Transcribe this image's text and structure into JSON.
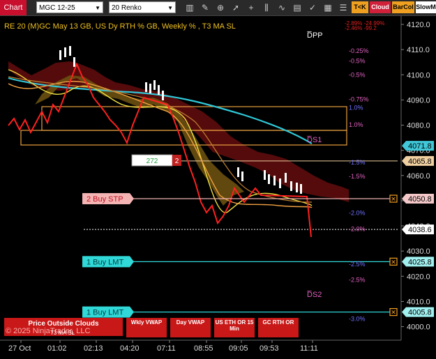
{
  "toolbar": {
    "chart_tab": "Chart",
    "instrument": "MGC 12-25",
    "bar_type": "20 Renko",
    "badges": [
      "T<K",
      "Cloud",
      "BarCol",
      "SlowM"
    ],
    "badge_colors": [
      "#f0a020",
      "#d0203a",
      "#f0a020",
      "#ffffff"
    ],
    "icons": [
      "bar-chart-icon",
      "drawing-tools-icon",
      "zoom-icon",
      "pointer-icon",
      "crosshair-icon",
      "bars-icon",
      "indicators-icon",
      "strategy-icon",
      "properties-icon",
      "data-box-icon"
    ]
  },
  "chart": {
    "header": "RE 20  (M)GC May 13 GB, US Dy RTH % GB, Weekly % , T3 MA SL",
    "top_right_overlap": [
      "-2.89%  -24.99%",
      "-2.46% -99.2"
    ],
    "zone_labels": {
      "dpp": "D̅PP",
      "ds1": "D̅S1",
      "ds2": "D̅S2"
    },
    "percent_labels": [
      {
        "text": "-0.25%",
        "price": 4109.5,
        "color": "#e060c0"
      },
      {
        "text": "-0.5%",
        "price": 4105.5,
        "color": "#e060c0"
      },
      {
        "text": "-0.5%",
        "price": 4100.0,
        "color": "#e060c0"
      },
      {
        "text": "-0.75%",
        "price": 4090.2,
        "color": "#e060c0"
      },
      {
        "text": "1.0%",
        "price": 4086.9,
        "color": "#7070ff"
      },
      {
        "text": "1.0%",
        "price": 4080.2,
        "color": "#e060c0"
      },
      {
        "text": "-1.5%",
        "price": 4065.2,
        "color": "#7070ff"
      },
      {
        "text": "-1.5%",
        "price": 4059.6,
        "color": "#e060c0"
      },
      {
        "text": "-2.0%",
        "price": 4045.2,
        "color": "#7070ff"
      },
      {
        "text": "-2.0%",
        "price": 4038.8,
        "color": "#e060c0"
      },
      {
        "text": "-2.5%",
        "price": 4024.8,
        "color": "#7070ff"
      },
      {
        "text": "-2.5%",
        "price": 4018.6,
        "color": "#e060c0"
      },
      {
        "text": "-3.0%",
        "price": 4003.0,
        "color": "#7070ff"
      }
    ],
    "price_axis": {
      "ticks": [
        "4120.0",
        "4110.0",
        "4100.0",
        "4090.0",
        "4080.0",
        "4070.0",
        "4060.0",
        "4050.0",
        "4040.0",
        "4030.0",
        "4020.0",
        "4010.0",
        "4000.0"
      ],
      "tick_values": [
        4120,
        4110,
        4100,
        4090,
        4080,
        4070,
        4060,
        4050,
        4040,
        4030,
        4020,
        4010,
        4000
      ],
      "markers": [
        {
          "label": "4071.8",
          "price": 4071.8,
          "bg": "#40c8d8",
          "fg": "#000000"
        },
        {
          "label": "4065.8",
          "price": 4065.8,
          "bg": "#f0d0a0",
          "fg": "#000000"
        },
        {
          "label": "4050.8",
          "price": 4050.8,
          "bg": "#f4c8c8",
          "fg": "#000000"
        },
        {
          "label": "4038.6",
          "price": 4038.6,
          "bg": "#ffffff",
          "fg": "#000000"
        },
        {
          "label": "4025.8",
          "price": 4025.8,
          "bg": "#a0f0f0",
          "fg": "#000000"
        },
        {
          "label": "4005.8",
          "price": 4005.8,
          "bg": "#a0f0f0",
          "fg": "#000000"
        }
      ]
    },
    "time_axis": {
      "labels": [
        "27 Oct",
        "01:02",
        "02:13",
        "04:20",
        "07:11",
        "08:55",
        "09:05",
        "09:53",
        "11:11"
      ]
    },
    "orders": [
      {
        "label": "2 Buy STP",
        "price": 4050.8,
        "color": "#f4b4b4",
        "fg": "#c01020"
      },
      {
        "label": "1 Buy LMT",
        "price": 4025.8,
        "color": "#30d8d8",
        "fg": "#004040"
      },
      {
        "label": "1 Buy LMT",
        "price": 4005.8,
        "color": "#30d8d8",
        "fg": "#004040"
      }
    ],
    "position_box": {
      "quantity": "272",
      "count": "2",
      "price": 4065.8
    },
    "last_price_line": 4038.6,
    "bottom_buttons": {
      "main": "Price Outside Clouds",
      "watermark": "© 2025 NinjaTrader, LLC",
      "overlap_text": "T3 MA SL",
      "buttons": [
        "Wkly VWAP",
        "Day VWAP",
        "US ETH OR 15 Min",
        "GC RTH OR"
      ]
    },
    "colors": {
      "bull": "#ffffff",
      "bear": "#ff2020",
      "cloud": "#6a1010",
      "cloud_gold": "#7a5a10",
      "ma_cyan": "#30c8d8",
      "ma_yellow": "#f0e040",
      "ma_orange": "#f0a040",
      "zone": "#e8a040"
    }
  }
}
